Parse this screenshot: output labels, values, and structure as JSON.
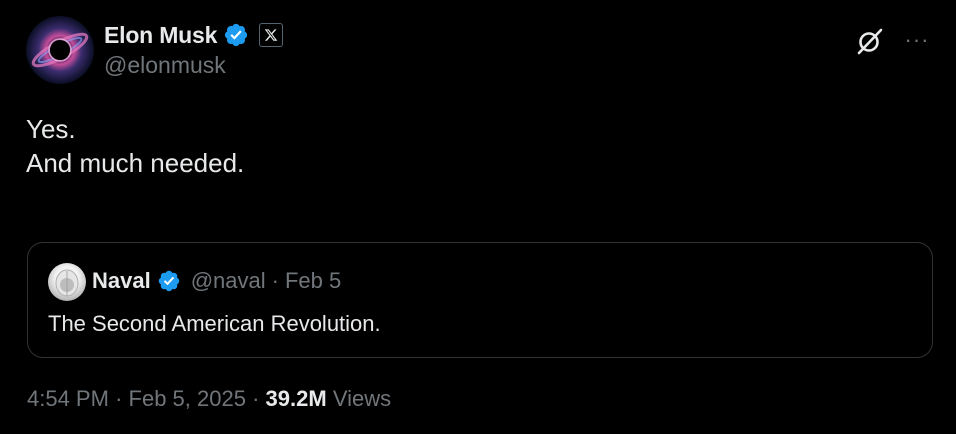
{
  "author": {
    "display_name": "Elon Musk",
    "handle": "@elonmusk",
    "verified_icon": "verified-badge-icon",
    "affiliation_icon": "x-logo-icon",
    "avatar_icon": "black-hole-avatar"
  },
  "actions": {
    "grok_icon": "grok-icon",
    "more_icon": "more-horizontal-icon",
    "more_glyph": "···"
  },
  "tweet": {
    "lines": [
      "Yes.",
      "",
      "And much needed."
    ]
  },
  "quoted": {
    "display_name": "Naval",
    "handle": "@naval",
    "separator": "·",
    "date": "Feb 5",
    "text": "The Second American Revolution."
  },
  "footer": {
    "time": "4:54 PM",
    "separator": "·",
    "date": "Feb 5, 2025",
    "views_count": "39.2M",
    "views_label": "Views"
  },
  "colors": {
    "background": "#000000",
    "primary_text": "#e7e9ea",
    "secondary_text": "#71767b",
    "verified_blue": "#1d9bf0",
    "border": "#2f3336"
  }
}
